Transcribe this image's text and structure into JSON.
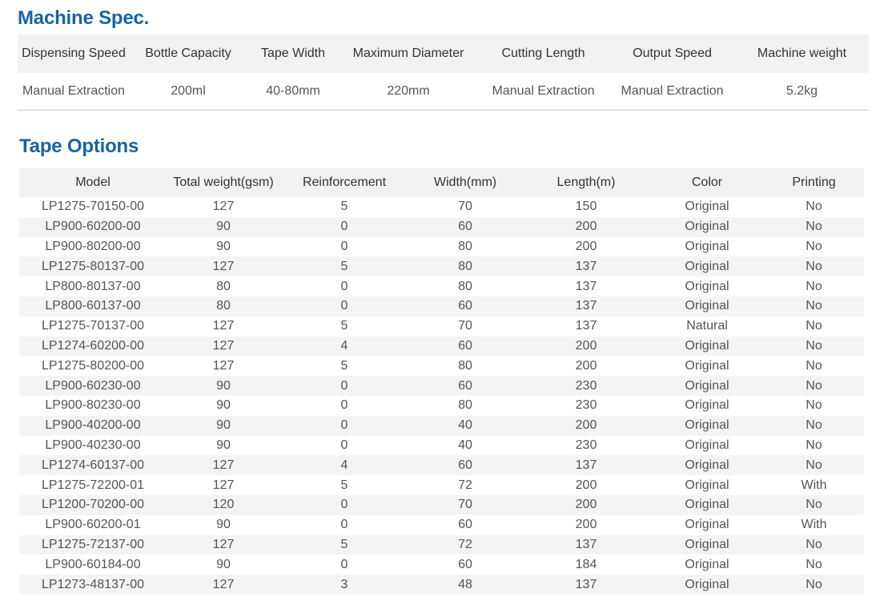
{
  "machine_spec": {
    "title": "Machine Spec.",
    "headers": [
      "Dispensing Speed",
      "Bottle Capacity",
      "Tape Width",
      "Maximum Diameter",
      "Cutting Length",
      "Output Speed",
      "Machine weight"
    ],
    "values": [
      "Manual Extraction",
      "200ml",
      "40-80mm",
      "220mm",
      "Manual Extraction",
      "Manual Extraction",
      "5.2kg"
    ]
  },
  "tape_options": {
    "title": "Tape Options",
    "headers": [
      "Model",
      "Total weight(gsm)",
      "Reinforcement",
      "Width(mm)",
      "Length(m)",
      "Color",
      "Printing"
    ],
    "rows": [
      [
        "LP1275-70150-00",
        "127",
        "5",
        "70",
        "150",
        "Original",
        "No"
      ],
      [
        "LP900-60200-00",
        "90",
        "0",
        "60",
        "200",
        "Original",
        "No"
      ],
      [
        "LP900-80200-00",
        "90",
        "0",
        "80",
        "200",
        "Original",
        "No"
      ],
      [
        "LP1275-80137-00",
        "127",
        "5",
        "80",
        "137",
        "Original",
        "No"
      ],
      [
        "LP800-80137-00",
        "80",
        "0",
        "80",
        "137",
        "Original",
        "No"
      ],
      [
        "LP800-60137-00",
        "80",
        "0",
        "60",
        "137",
        "Original",
        "No"
      ],
      [
        "LP1275-70137-00",
        "127",
        "5",
        "70",
        "137",
        "Natural",
        "No"
      ],
      [
        "LP1274-60200-00",
        "127",
        "4",
        "60",
        "200",
        "Original",
        "No"
      ],
      [
        "LP1275-80200-00",
        "127",
        "5",
        "80",
        "200",
        "Original",
        "No"
      ],
      [
        "LP900-60230-00",
        "90",
        "0",
        "60",
        "230",
        "Original",
        "No"
      ],
      [
        "LP900-80230-00",
        "90",
        "0",
        "80",
        "230",
        "Original",
        "No"
      ],
      [
        "LP900-40200-00",
        "90",
        "0",
        "40",
        "200",
        "Original",
        "No"
      ],
      [
        "LP900-40230-00",
        "90",
        "0",
        "40",
        "230",
        "Original",
        "No"
      ],
      [
        "LP1274-60137-00",
        "127",
        "4",
        "60",
        "137",
        "Original",
        "No"
      ],
      [
        "LP1275-72200-01",
        "127",
        "5",
        "72",
        "200",
        "Original",
        "With"
      ],
      [
        "LP1200-70200-00",
        "120",
        "0",
        "70",
        "200",
        "Original",
        "No"
      ],
      [
        "LP900-60200-01",
        "90",
        "0",
        "60",
        "200",
        "Original",
        "With"
      ],
      [
        "LP1275-72137-00",
        "127",
        "5",
        "72",
        "137",
        "Original",
        "No"
      ],
      [
        "LP900-60184-00",
        "90",
        "0",
        "60",
        "184",
        "Original",
        "No"
      ],
      [
        "LP1273-48137-00",
        "127",
        "3",
        "48",
        "137",
        "Original",
        "No"
      ]
    ]
  }
}
